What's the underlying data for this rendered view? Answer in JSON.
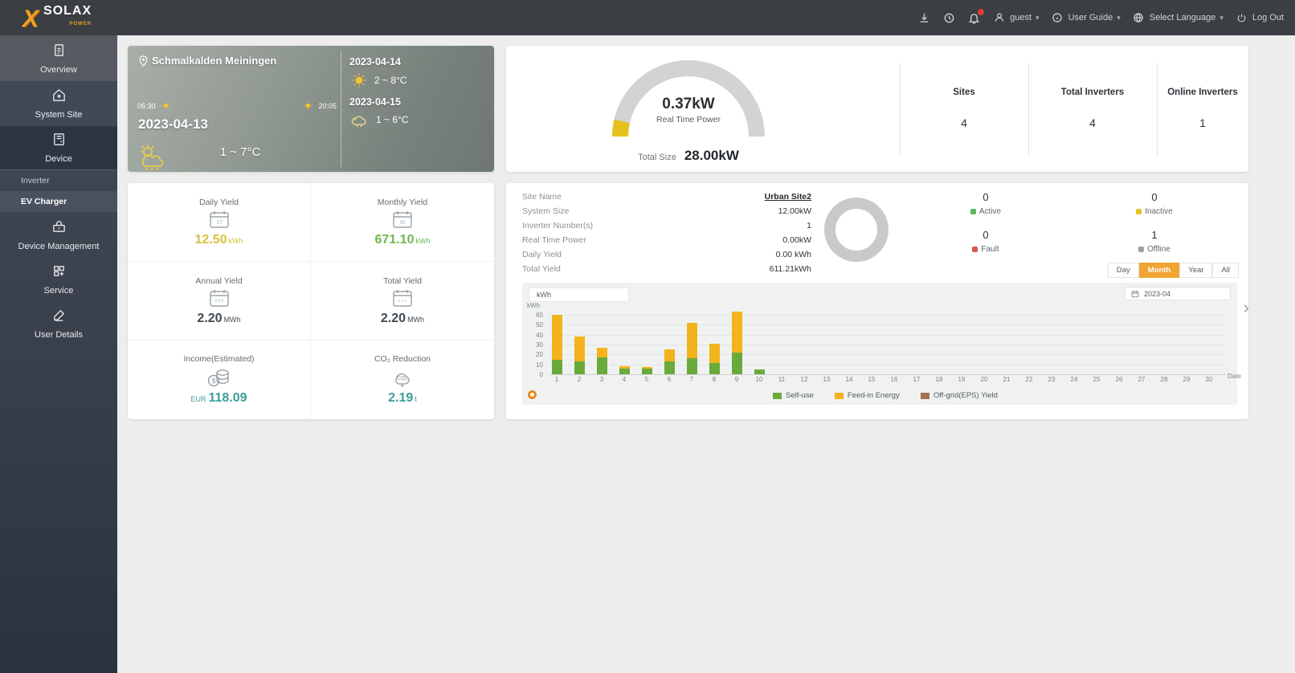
{
  "header": {
    "logo_text": "SOLAX",
    "logo_sub": "POWER",
    "user": "guest",
    "user_guide": "User Guide",
    "select_language": "Select Language",
    "log_out": "Log Out"
  },
  "sidebar": {
    "items": [
      {
        "label": "Overview",
        "icon": "overview-icon"
      },
      {
        "label": "System Site",
        "icon": "site-icon"
      },
      {
        "label": "Device",
        "icon": "device-icon"
      },
      {
        "label": "Device Management",
        "icon": "device-management-icon"
      },
      {
        "label": "Service",
        "icon": "service-icon"
      },
      {
        "label": "User Details",
        "icon": "user-details-icon"
      }
    ],
    "device_submenu": [
      {
        "label": "Inverter",
        "active": false
      },
      {
        "label": "EV Charger",
        "active": true
      }
    ]
  },
  "weather": {
    "location": "Schmalkalden Meiningen",
    "sunrise": "06:30",
    "sunset": "20:05",
    "today_date": "2023-04-13",
    "today_temp": "1 ~ 7°C",
    "forecast": [
      {
        "date": "2023-04-14",
        "temp": "2 ~ 8°C",
        "icon": "sun-icon"
      },
      {
        "date": "2023-04-15",
        "temp": "1 ~ 6°C",
        "icon": "cloud-rain-icon"
      }
    ]
  },
  "power_summary": {
    "real_time_power_value": "0.37kW",
    "real_time_power_label": "Real Time Power",
    "total_size_label": "Total Size",
    "total_size_value": "28.00kW",
    "gauge_color": "#e8c21c",
    "gauge_track": "#d2d3d4",
    "stats": [
      {
        "label": "Sites",
        "value": "4"
      },
      {
        "label": "Total Inverters",
        "value": "4"
      },
      {
        "label": "Online Inverters",
        "value": "1"
      }
    ]
  },
  "yields": [
    {
      "label": "Daily Yield",
      "prefix": "",
      "value": "12.50",
      "unit": "kWh",
      "color": "#d9c13a"
    },
    {
      "label": "Monthly Yield",
      "prefix": "",
      "value": "671.10",
      "unit": "kWh",
      "color": "#6db84e"
    },
    {
      "label": "Annual Yield",
      "prefix": "",
      "value": "2.20",
      "unit": "MWh",
      "color": "#3f4a55"
    },
    {
      "label": "Total Yield",
      "prefix": "",
      "value": "2.20",
      "unit": "MWh",
      "color": "#3f4a55"
    },
    {
      "label": "Income(Estimated)",
      "prefix": "EUR",
      "value": "118.09",
      "unit": "",
      "color": "#3a9e97"
    },
    {
      "label": "CO₂ Reduction",
      "prefix": "",
      "value": "2.19",
      "unit": "t",
      "color": "#3a9e97"
    }
  ],
  "site_details": {
    "rows": [
      {
        "label": "Site Name",
        "value": "Urban Site2",
        "link": true
      },
      {
        "label": "System Size",
        "value": "12.00kW"
      },
      {
        "label": "Inverter Number(s)",
        "value": "1"
      },
      {
        "label": "Real Time Power",
        "value": "0.00kW"
      },
      {
        "label": "Daily Yield",
        "value": "0.00 kWh"
      },
      {
        "label": "Total Yield",
        "value": "611.21kWh"
      }
    ],
    "donut_color": "#c9c9c9"
  },
  "status": [
    {
      "count": "0",
      "label": "Active",
      "color": "#5cb85c"
    },
    {
      "count": "0",
      "label": "Inactive",
      "color": "#e3c41d"
    },
    {
      "count": "0",
      "label": "Fault",
      "color": "#d9534f"
    },
    {
      "count": "1",
      "label": "Offline",
      "color": "#9aa0a6"
    }
  ],
  "period_tabs": {
    "options": [
      "Day",
      "Month",
      "Year",
      "All"
    ],
    "active": "Month"
  },
  "chart_controls": {
    "unit_select": "kWh",
    "date_picker": "2023-04"
  },
  "chart_data": {
    "type": "bar",
    "stacked": true,
    "x": [
      1,
      2,
      3,
      4,
      5,
      6,
      7,
      8,
      9,
      10,
      11,
      12,
      13,
      14,
      15,
      16,
      17,
      18,
      19,
      20,
      21,
      22,
      23,
      24,
      25,
      26,
      27,
      28,
      29,
      30
    ],
    "series": [
      {
        "name": "Self-use",
        "color": "#6aaa3c",
        "values": [
          15,
          13,
          17,
          6,
          6,
          13,
          16,
          11,
          22,
          5,
          0,
          0,
          0,
          0,
          0,
          0,
          0,
          0,
          0,
          0,
          0,
          0,
          0,
          0,
          0,
          0,
          0,
          0,
          0,
          0
        ]
      },
      {
        "name": "Feed-in Energy",
        "color": "#f2b31c",
        "values": [
          45,
          25,
          10,
          2,
          1,
          12,
          36,
          20,
          41,
          0,
          0,
          0,
          0,
          0,
          0,
          0,
          0,
          0,
          0,
          0,
          0,
          0,
          0,
          0,
          0,
          0,
          0,
          0,
          0,
          0
        ]
      },
      {
        "name": "Off-grid(EPS) Yield",
        "color": "#a87152",
        "values": [
          0,
          0,
          0,
          0,
          0,
          0,
          0,
          0,
          0,
          0,
          0,
          0,
          0,
          0,
          0,
          0,
          0,
          0,
          0,
          0,
          0,
          0,
          0,
          0,
          0,
          0,
          0,
          0,
          0,
          0
        ]
      }
    ],
    "ylabel": "kWh",
    "xlabel": "Date",
    "yticks": [
      0,
      10,
      20,
      30,
      40,
      50,
      60
    ],
    "ylim": [
      0,
      65
    ],
    "grid": true,
    "legend_position": "bottom"
  }
}
